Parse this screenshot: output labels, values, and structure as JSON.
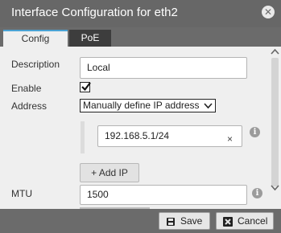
{
  "dialog": {
    "title": "Interface Configuration for eth2",
    "close_icon": "close-icon"
  },
  "tabs": [
    {
      "label": "Config",
      "active": true
    },
    {
      "label": "PoE",
      "active": false
    }
  ],
  "form": {
    "description_label": "Description",
    "description_value": "Local",
    "enable_label": "Enable",
    "enable_checked": true,
    "address_label": "Address",
    "address_mode": "Manually define IP address",
    "ip_address": "192.168.5.1/24",
    "clear_glyph": "×",
    "add_ip_label": "+ Add IP",
    "mtu_label": "MTU",
    "mtu_value": "1500",
    "info_glyph": "i"
  },
  "footer": {
    "save_label": "Save",
    "cancel_label": "Cancel"
  },
  "colors": {
    "accent_tab": "#4aa3d4",
    "titlebar": "#676767",
    "panel": "#efefef"
  }
}
